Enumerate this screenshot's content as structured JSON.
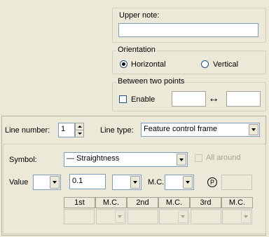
{
  "upper_note": {
    "label": "Upper note:",
    "value": ""
  },
  "orientation": {
    "label": "Orientation",
    "options": [
      "Horizontal",
      "Vertical"
    ],
    "selected": "Horizontal"
  },
  "between_two_points": {
    "label": "Between two points",
    "enable_label": "Enable",
    "enabled": false,
    "arrow_glyph": "↔",
    "left_value": "",
    "right_value": ""
  },
  "line": {
    "number_label": "Line number:",
    "number_value": "1",
    "type_label": "Line type:",
    "type_value": "Feature control frame"
  },
  "symbol": {
    "label": "Symbol:",
    "value": "—   Straightness",
    "all_around_label": "All around",
    "all_around_checked": false
  },
  "value_row": {
    "label": "Value",
    "prefix_value": "",
    "value": "0.1",
    "modifier_value": "",
    "mc_label": "M.C.",
    "mc_value": "",
    "p_symbol": "P",
    "p_value": ""
  },
  "datum_headers": [
    "1st",
    "M.C.",
    "2nd",
    "M.C.",
    "3rd",
    "M.C."
  ]
}
